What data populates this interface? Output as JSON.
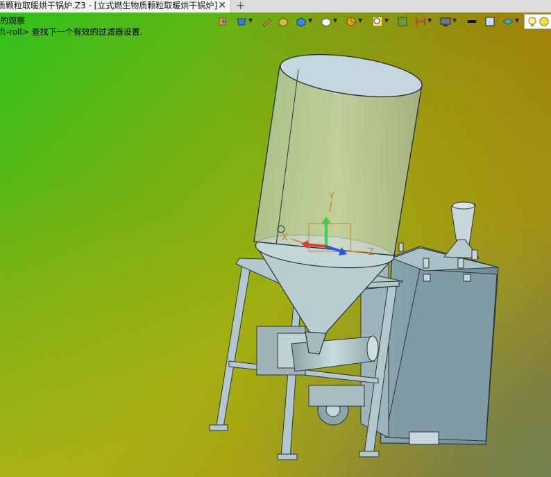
{
  "window": {
    "tab_title": "质颗粒取暖烘干锅炉.Z3 - [立式燃生物质颗粒取暖烘干锅炉]",
    "tab_close": "✕",
    "new_tab": "+"
  },
  "messages": {
    "line1": "的观察",
    "line2": "ft-roll> 查找下一个有效的过滤器设置."
  },
  "toolbar": {
    "icons": [
      "exit-view-icon",
      "render-mode-icon",
      "pen-icon",
      "shaded-cube-icon",
      "blue-cube-icon",
      "white-cube-icon",
      "pie-icon",
      "zoom-icon",
      "fit-icon",
      "section-icon",
      "display-icon",
      "line-color-icon",
      "face-color-icon",
      "material-icon",
      "lamp-icon"
    ]
  },
  "triad": {
    "x": "X",
    "y": "Y",
    "z": "Z"
  },
  "colors": {
    "body": "#b8d0d4",
    "edge": "#2a3438",
    "axis_x": "#e03a3a",
    "axis_y": "#3ad04a",
    "axis_z": "#2a5ae0",
    "triad_label": "#d08020"
  }
}
